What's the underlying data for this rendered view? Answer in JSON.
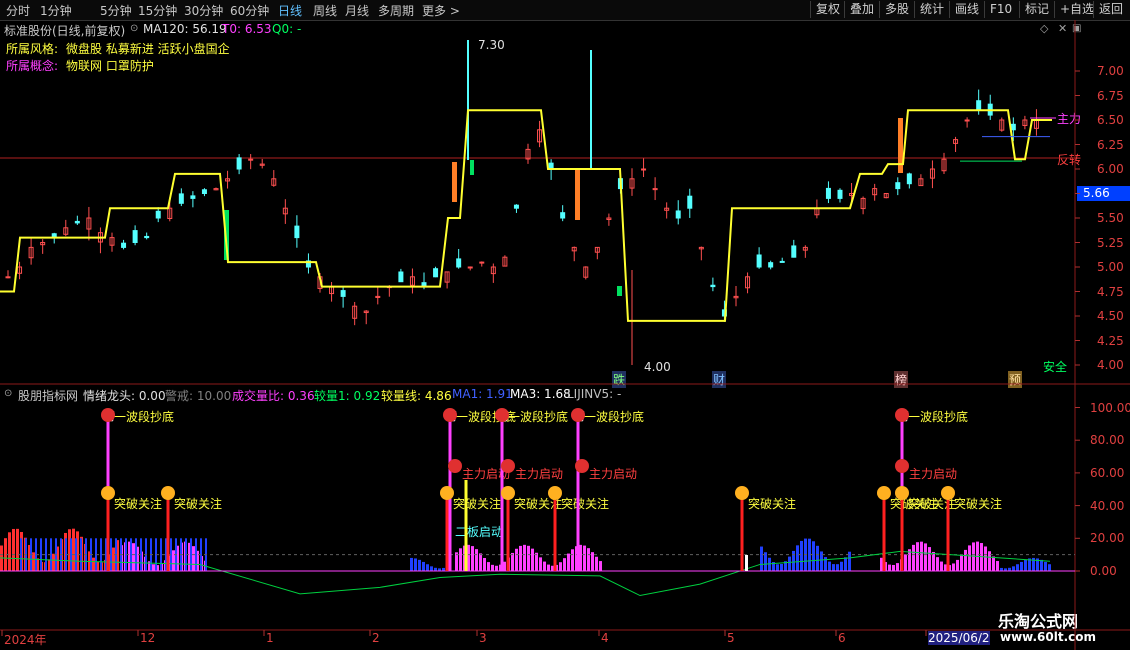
{
  "toolbar": {
    "periods": [
      "分时",
      "1分钟",
      "5分钟",
      "15分钟",
      "30分钟",
      "60分钟",
      "日线",
      "周线",
      "月线",
      "多周期",
      "更多 >"
    ],
    "active_period": "日线",
    "actions": [
      "复权",
      "叠加",
      "多股",
      "统计",
      "画线",
      "F10",
      "标记",
      "+自选",
      "返回"
    ]
  },
  "main_panel": {
    "title": "标准股份(日线,前复权)",
    "ma_label": "MA120: 56.19",
    "t0_label": "T0: 6.53",
    "q0_label": "Q0: -",
    "style_label": "所属风格:",
    "style_value": "微盘股 私募新进 活跃小盘国企",
    "concept_label": "所属概念:",
    "concept_value": "物联网 口罩防护",
    "high_label": "7.30",
    "low_label": "4.00",
    "current_price": "5.66",
    "markers": [
      "跌",
      "财",
      "榜",
      "预"
    ],
    "right_tags": [
      "主力",
      "反转"
    ],
    "safe_label": "安全",
    "price_ticks": [
      "7.00",
      "6.75",
      "6.50",
      "6.25",
      "6.00",
      "5.75",
      "5.50",
      "5.25",
      "5.00",
      "4.75",
      "4.50",
      "4.25",
      "4.00"
    ],
    "colors": {
      "up": "#ff5050",
      "down": "#54ffff",
      "orange": "#ff7f27",
      "green": "#00e060",
      "yellow": "#ffff30",
      "bg": "#000000"
    }
  },
  "indicator_panel": {
    "title": "股朋指标网",
    "items": [
      {
        "text": "情绪龙头: 0.00",
        "color": "#e0e0e0"
      },
      {
        "text": "警戒: 10.00",
        "color": "#808080"
      },
      {
        "text": "成交量比: 0.36",
        "color": "#ff40ff"
      },
      {
        "text": "较量1: 0.92",
        "color": "#00ff60"
      },
      {
        "text": "较量线: 4.86",
        "color": "#ffff40"
      },
      {
        "text": "MA1: 1.91",
        "color": "#4060ff"
      },
      {
        "text": "MA3: 1.68",
        "color": "#ffffff"
      },
      {
        "text": "LIJINV5: -",
        "color": "#c0c0c0"
      }
    ],
    "ticks": [
      "100.00",
      "80.00",
      "60.00",
      "40.00",
      "20.00",
      "0.00"
    ],
    "signals": {
      "bang": "榜",
      "wave": "一波段抄底",
      "start": "主力启动",
      "break": "突破关注",
      "second": "二板启动",
      "can": "参"
    }
  },
  "time_axis": {
    "labels": [
      "2024年",
      "12",
      "1",
      "2",
      "3",
      "4",
      "5",
      "6",
      "2025/06/2"
    ]
  },
  "watermark": {
    "line1": "乐淘公式网",
    "line2": "www.60lt.com"
  }
}
